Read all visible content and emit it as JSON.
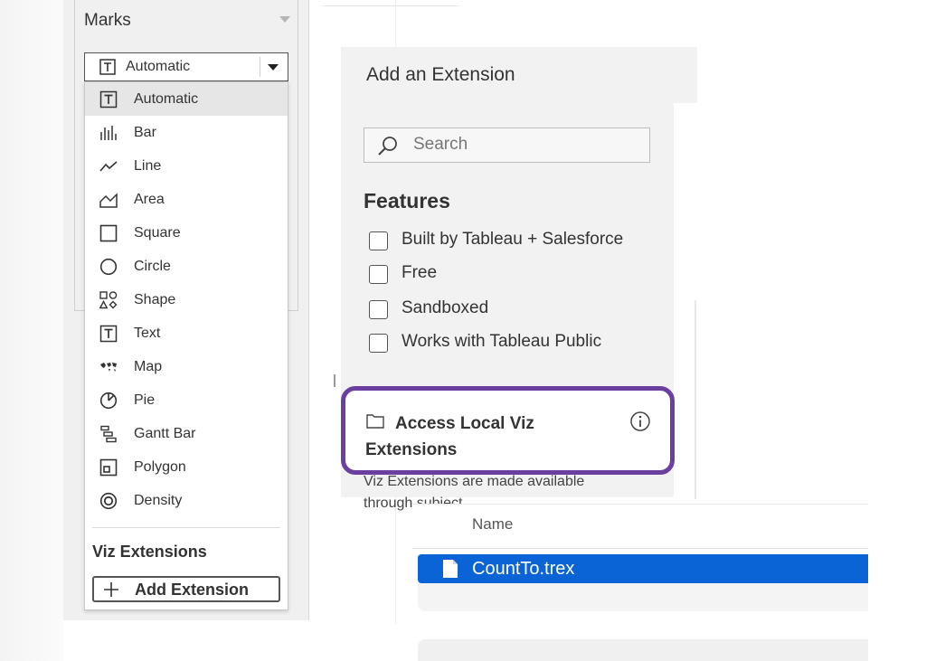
{
  "marks": {
    "header": "Marks",
    "selected_value": "Automatic",
    "items": [
      {
        "label": "Automatic",
        "icon": "text-t-icon"
      },
      {
        "label": "Bar",
        "icon": "bar-icon"
      },
      {
        "label": "Line",
        "icon": "line-icon"
      },
      {
        "label": "Area",
        "icon": "area-icon"
      },
      {
        "label": "Square",
        "icon": "square-icon"
      },
      {
        "label": "Circle",
        "icon": "circle-icon"
      },
      {
        "label": "Shape",
        "icon": "shape-icon"
      },
      {
        "label": "Text",
        "icon": "text-t-icon"
      },
      {
        "label": "Map",
        "icon": "map-icon"
      },
      {
        "label": "Pie",
        "icon": "pie-icon"
      },
      {
        "label": "Gantt Bar",
        "icon": "gantt-icon"
      },
      {
        "label": "Polygon",
        "icon": "polygon-icon"
      },
      {
        "label": "Density",
        "icon": "density-icon"
      }
    ],
    "viz_extensions_heading": "Viz Extensions",
    "add_extension_label": "Add Extension"
  },
  "extension_dialog": {
    "title": "Add an Extension",
    "search_placeholder": "Search",
    "features_heading": "Features",
    "features": [
      {
        "label": "Built by Tableau + Salesforce",
        "checked": false
      },
      {
        "label": "Free",
        "checked": false
      },
      {
        "label": "Sandboxed",
        "checked": false
      },
      {
        "label": "Works with Tableau Public",
        "checked": false
      }
    ],
    "local_extensions_title": "Access Local Viz Extensions",
    "description": "Viz Extensions are made available through subject"
  },
  "file_list": {
    "column_header": "Name",
    "files": [
      {
        "name": "CountTo.trex",
        "selected": true
      }
    ]
  },
  "colors": {
    "highlight_border": "#6a3fa0",
    "selection_blue": "#0b64d6"
  }
}
